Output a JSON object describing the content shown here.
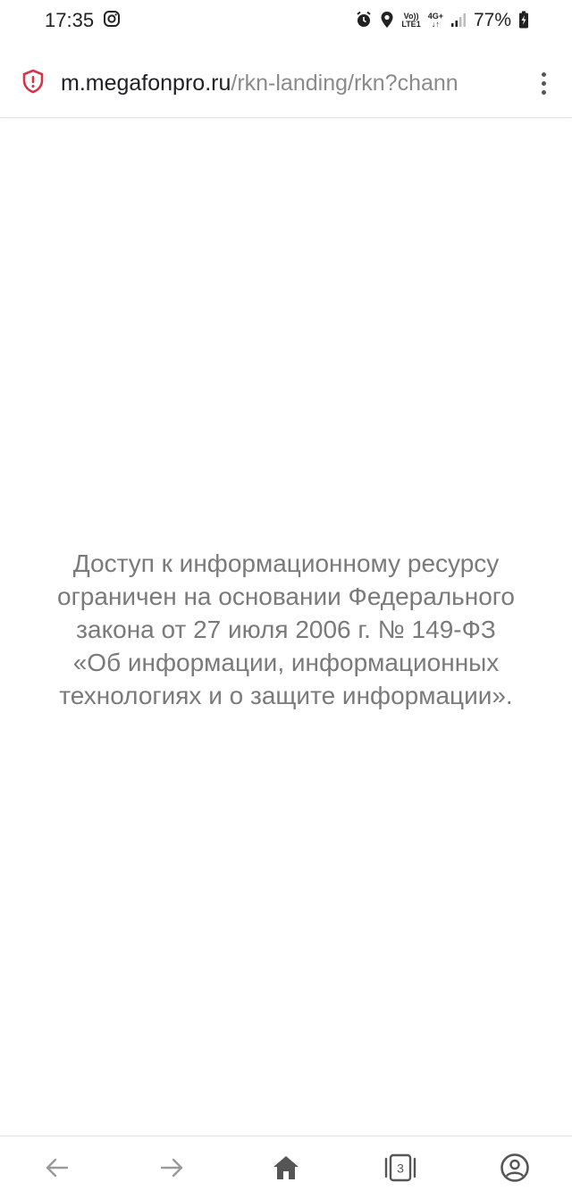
{
  "status_bar": {
    "time": "17:35",
    "network_top": "Vo))",
    "network_bottom": "LTE1",
    "network_type": "4G+",
    "battery": "77%",
    "icons": [
      "instagram-icon",
      "alarm-icon",
      "location-icon",
      "signal-icon",
      "battery-icon"
    ]
  },
  "address_bar": {
    "host": "m.megafonpro.ru",
    "path": "/rkn-landing/rkn?chann",
    "security_icon": "shield-warning-icon",
    "security_color": "#d2344a",
    "menu_icon": "more-vertical-icon"
  },
  "main": {
    "notice_lines": [
      "Доступ к информационному ресурсу",
      "ограничен на основании Федерального",
      "закона от 27 июля 2006 г. № 149-ФЗ",
      "«Об информации, информационных",
      "технологиях и о защите информации»."
    ]
  },
  "bottom_nav": {
    "tab_count": "3",
    "buttons": [
      "back-icon",
      "forward-icon",
      "home-icon",
      "tabs-icon",
      "account-icon"
    ]
  }
}
